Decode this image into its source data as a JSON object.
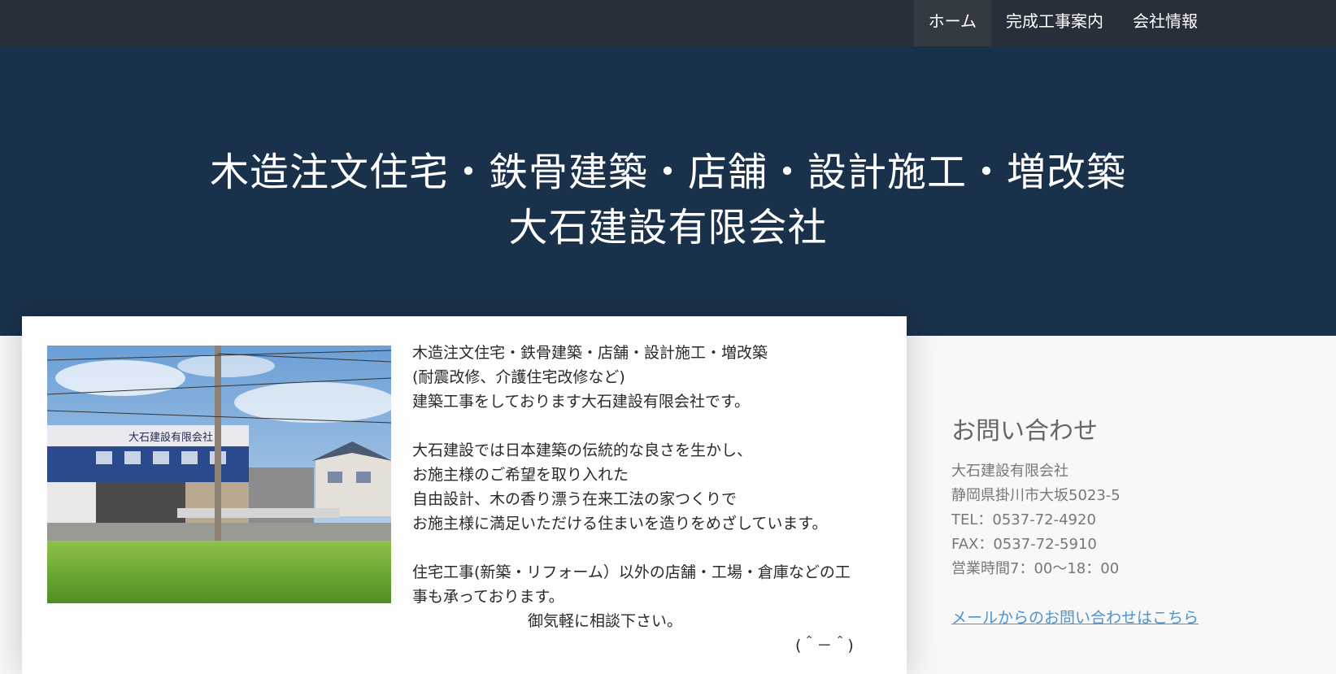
{
  "nav": {
    "items": [
      {
        "label": "ホーム",
        "active": true
      },
      {
        "label": "完成工事案内",
        "active": false
      },
      {
        "label": "会社情報",
        "active": false
      }
    ]
  },
  "hero": {
    "line1": "木造注文住宅・鉄骨建築・店舗・設計施工・増改築",
    "line2": "大石建設有限会社"
  },
  "photo": {
    "sign_text": "大石建設有限会社",
    "description_icon": "building-photo"
  },
  "intro": {
    "p1": [
      "木造注文住宅・鉄骨建築・店舗・設計施工・増改築",
      "(耐震改修、介護住宅改修など)",
      "建築工事をしております大石建設有限会社です。"
    ],
    "p2": [
      "大石建設では日本建築の伝統的な良さを生かし、",
      "お施主様のご希望を取り入れた",
      "自由設計、木の香り漂う在来工法の家つくりで",
      "お施主様に満足いただける住まいを造りをめざしています。"
    ],
    "p3": [
      "住宅工事(新築・リフォーム）以外の店舗・工場・倉庫などの工",
      "事も承っております。"
    ],
    "consult": "御気軽に相談下さい。",
    "face": "(＾－＾)"
  },
  "contact": {
    "title": "お問い合わせ",
    "company": "大石建設有限会社",
    "address": "静岡県掛川市大坂5023‐5",
    "tel": "TEL：0537-72-4920",
    "fax": "FAX：0537-72-5910",
    "hours": "営業時間7：00～18：00",
    "mail_link": "メールからのお問い合わせはこちら"
  },
  "colors": {
    "topbar": "#272f3a",
    "hero": "#19314a",
    "link": "#4d94cf"
  }
}
